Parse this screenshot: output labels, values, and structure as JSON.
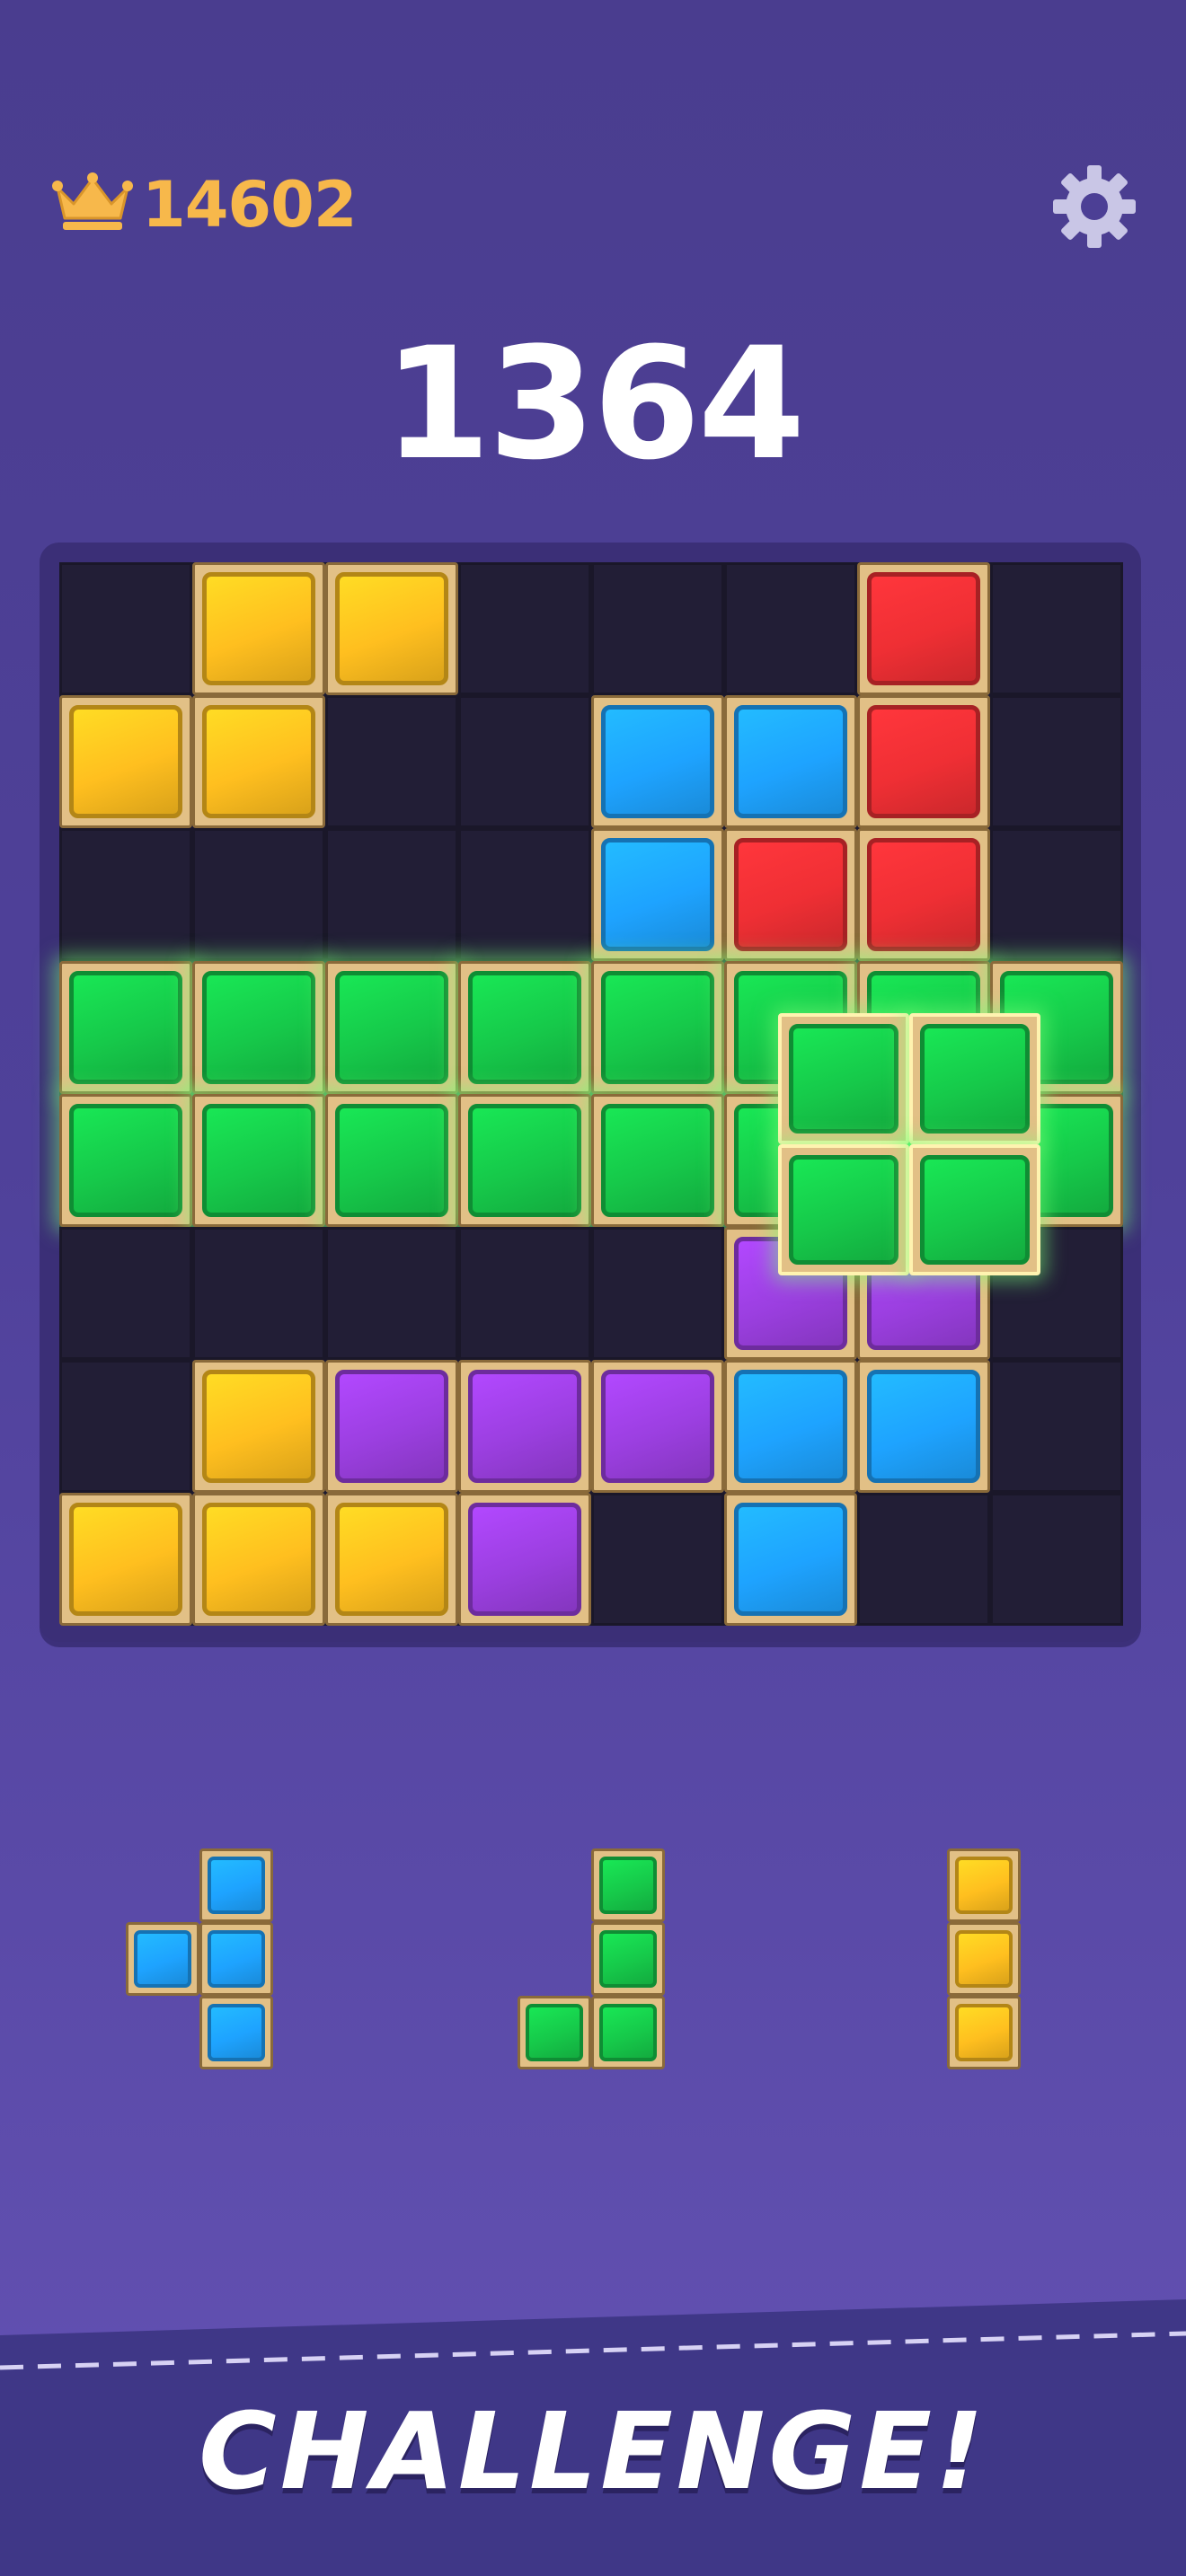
{
  "header": {
    "best_score": "14602",
    "best_icon": "crown-icon",
    "settings_icon": "gear-icon",
    "score": "1364"
  },
  "colors": {
    "yellow": "#ffbf1f",
    "red": "#ef2f34",
    "blue": "#1ea3ff",
    "green": "#16c94a",
    "purple": "#9b3fe0"
  },
  "board": {
    "size": 8,
    "rows": [
      [
        ".",
        "Y",
        "Y",
        ".",
        ".",
        ".",
        "R",
        "."
      ],
      [
        "Y",
        "Y",
        ".",
        ".",
        "B",
        "B",
        "R",
        "."
      ],
      [
        ".",
        ".",
        ".",
        ".",
        "B",
        "R",
        "R",
        "."
      ],
      [
        "G",
        "G",
        "G",
        "G",
        "G",
        "G",
        "G",
        "G"
      ],
      [
        "G",
        "G",
        "G",
        "G",
        "G",
        "G",
        "G",
        "G"
      ],
      [
        ".",
        ".",
        ".",
        ".",
        ".",
        "P",
        "P",
        "."
      ],
      [
        ".",
        "Y",
        "P",
        "P",
        "P",
        "B",
        "B",
        "."
      ],
      [
        "Y",
        "Y",
        "Y",
        "P",
        ".",
        "B",
        ".",
        "."
      ]
    ],
    "highlighted_rows": [
      3,
      4
    ]
  },
  "dragged_piece": {
    "color": "G",
    "cells": [
      [
        0,
        0
      ],
      [
        0,
        1
      ],
      [
        1,
        0
      ],
      [
        1,
        1
      ]
    ]
  },
  "tray": [
    {
      "color": "B",
      "cells": [
        [
          0,
          1
        ],
        [
          1,
          0
        ],
        [
          1,
          1
        ],
        [
          2,
          1
        ]
      ]
    },
    {
      "color": "G",
      "cells": [
        [
          0,
          1
        ],
        [
          1,
          1
        ],
        [
          2,
          0
        ],
        [
          2,
          1
        ]
      ]
    },
    {
      "color": "Y",
      "cells": [
        [
          0,
          0
        ],
        [
          1,
          0
        ],
        [
          2,
          0
        ]
      ]
    }
  ],
  "banner": {
    "text": "CHALLENGE!"
  }
}
